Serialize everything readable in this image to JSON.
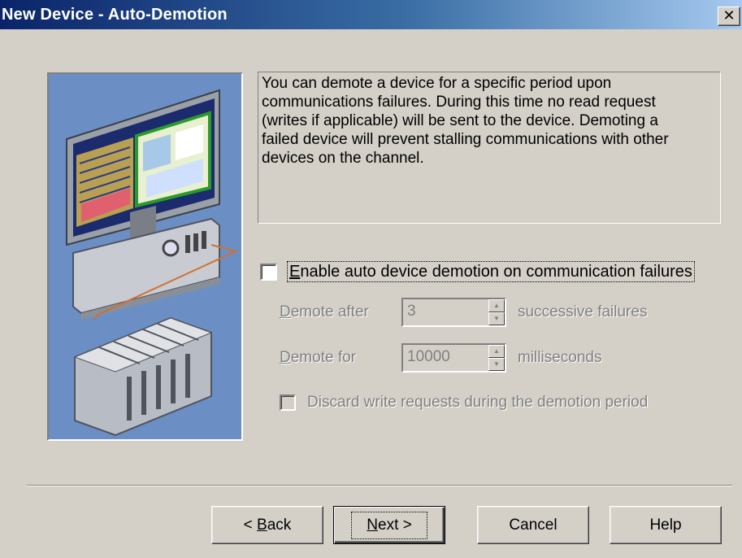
{
  "window": {
    "title": "New Device - Auto-Demotion",
    "close_label": "✕"
  },
  "description": "You can demote a device for a specific period upon\ncommunications failures. During this time no read request\n(writes if applicable) will be sent to the device. Demoting a\nfailed device will prevent stalling communications with other\ndevices on the channel.",
  "enable": {
    "checked": false,
    "label_prefix": "",
    "label_accel": "E",
    "label_rest": "nable auto device demotion on communication failures"
  },
  "demote_after": {
    "label_accel": "D",
    "label_rest": "emote after",
    "value": "3",
    "unit": "successive failures"
  },
  "demote_for": {
    "label_accel": "D",
    "label_rest": "emote for",
    "value": "10000",
    "unit": "milliseconds"
  },
  "discard": {
    "checked": false,
    "label": "Discard write requests during the demotion period"
  },
  "buttons": {
    "back_prefix": "< ",
    "back_accel": "B",
    "back_rest": "ack",
    "next_accel": "N",
    "next_rest": "ext >",
    "cancel": "Cancel",
    "help": "Help"
  },
  "colors": {
    "titlebar_start": "#0a246a",
    "titlebar_end": "#a6caf0",
    "dialog_bg": "#d4d0c8",
    "illustration_bg": "#6b8fc5"
  }
}
